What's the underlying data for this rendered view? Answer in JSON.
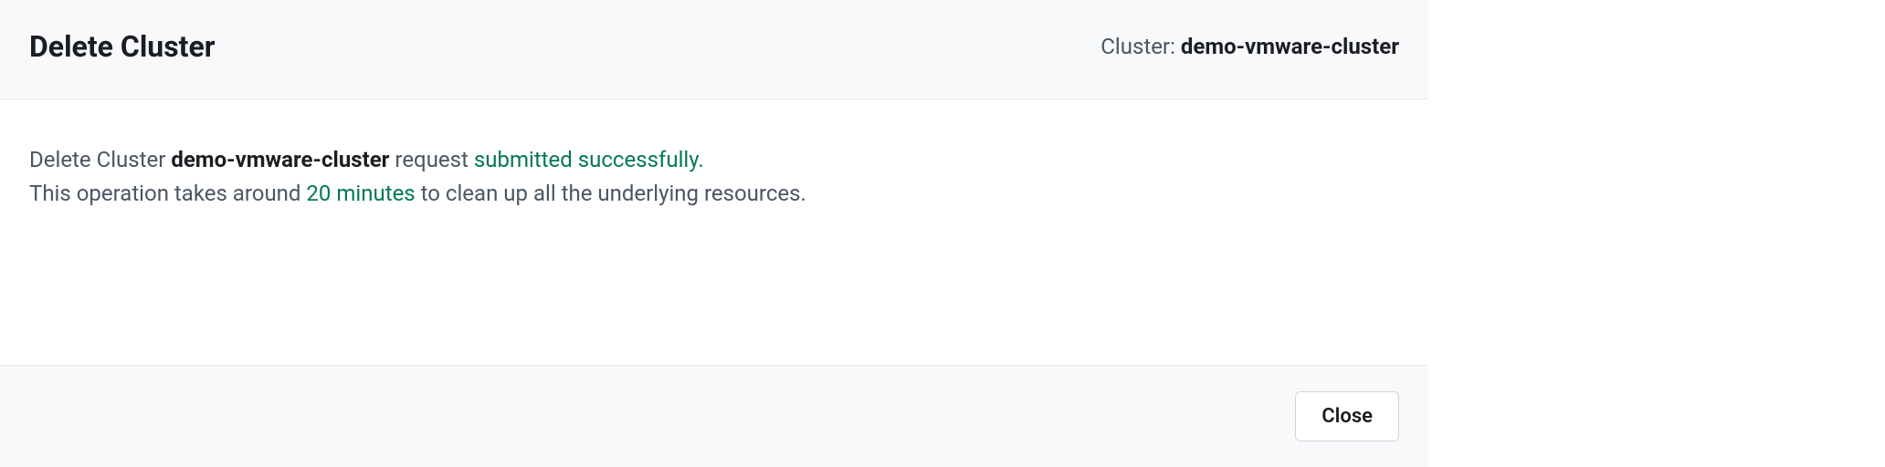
{
  "header": {
    "title": "Delete Cluster",
    "cluster_label": "Cluster: ",
    "cluster_name": "demo-vmware-cluster"
  },
  "body": {
    "line1_prefix": "Delete Cluster ",
    "line1_cluster": "demo-vmware-cluster",
    "line1_middle": " request ",
    "line1_success": "submitted successfully.",
    "line2_prefix": "This operation takes around ",
    "line2_duration": "20 minutes",
    "line2_suffix": " to clean up all the underlying resources."
  },
  "footer": {
    "close_label": "Close"
  }
}
